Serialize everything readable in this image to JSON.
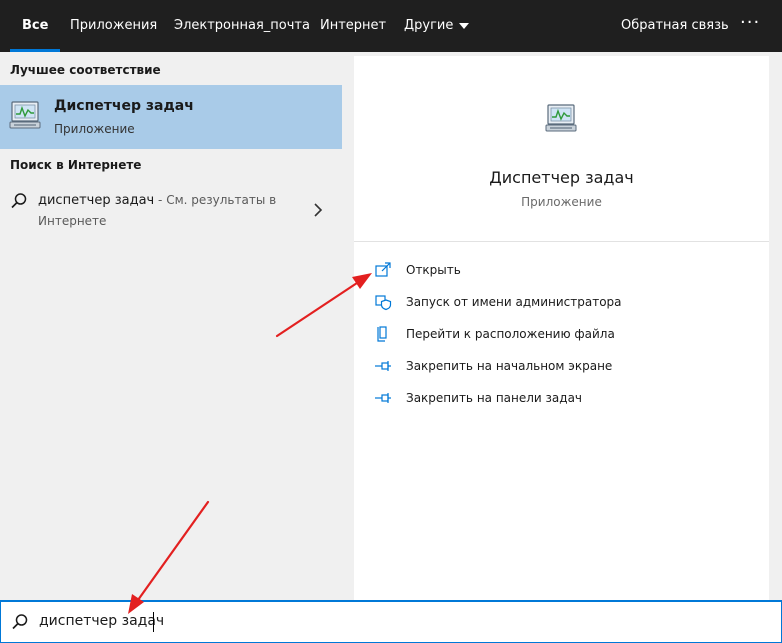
{
  "nav": {
    "tabs": [
      {
        "label": "Все",
        "active": true
      },
      {
        "label": "Приложения"
      },
      {
        "label": "Электронная_почта"
      },
      {
        "label": "Интернет"
      },
      {
        "label": "Другие"
      }
    ],
    "feedback": "Обратная связь",
    "more": "···"
  },
  "left": {
    "best_match_header": "Лучшее соответствие",
    "best_match": {
      "title": "Диспетчер задач",
      "subtitle": "Приложение",
      "icon": "task-manager-icon"
    },
    "web_header": "Поиск в Интернете",
    "web_result": {
      "query": "диспетчер задач",
      "suffix": " - См. результаты в Интернете",
      "icon": "search-icon"
    }
  },
  "preview": {
    "title": "Диспетчер задач",
    "subtitle": "Приложение",
    "actions": [
      {
        "label": "Открыть",
        "icon": "open-icon"
      },
      {
        "label": "Запуск от имени администратора",
        "icon": "shield-icon"
      },
      {
        "label": "Перейти к расположению файла",
        "icon": "file-location-icon"
      },
      {
        "label": "Закрепить на начальном экране",
        "icon": "pin-icon"
      },
      {
        "label": "Закрепить на панели задач",
        "icon": "pin-icon"
      }
    ]
  },
  "search": {
    "value": "диспетчер задач"
  },
  "colors": {
    "accent": "#0078d7",
    "nav_bg": "#1f1f1f",
    "selection": "#a9cbe8",
    "annotation": "#e32020"
  }
}
